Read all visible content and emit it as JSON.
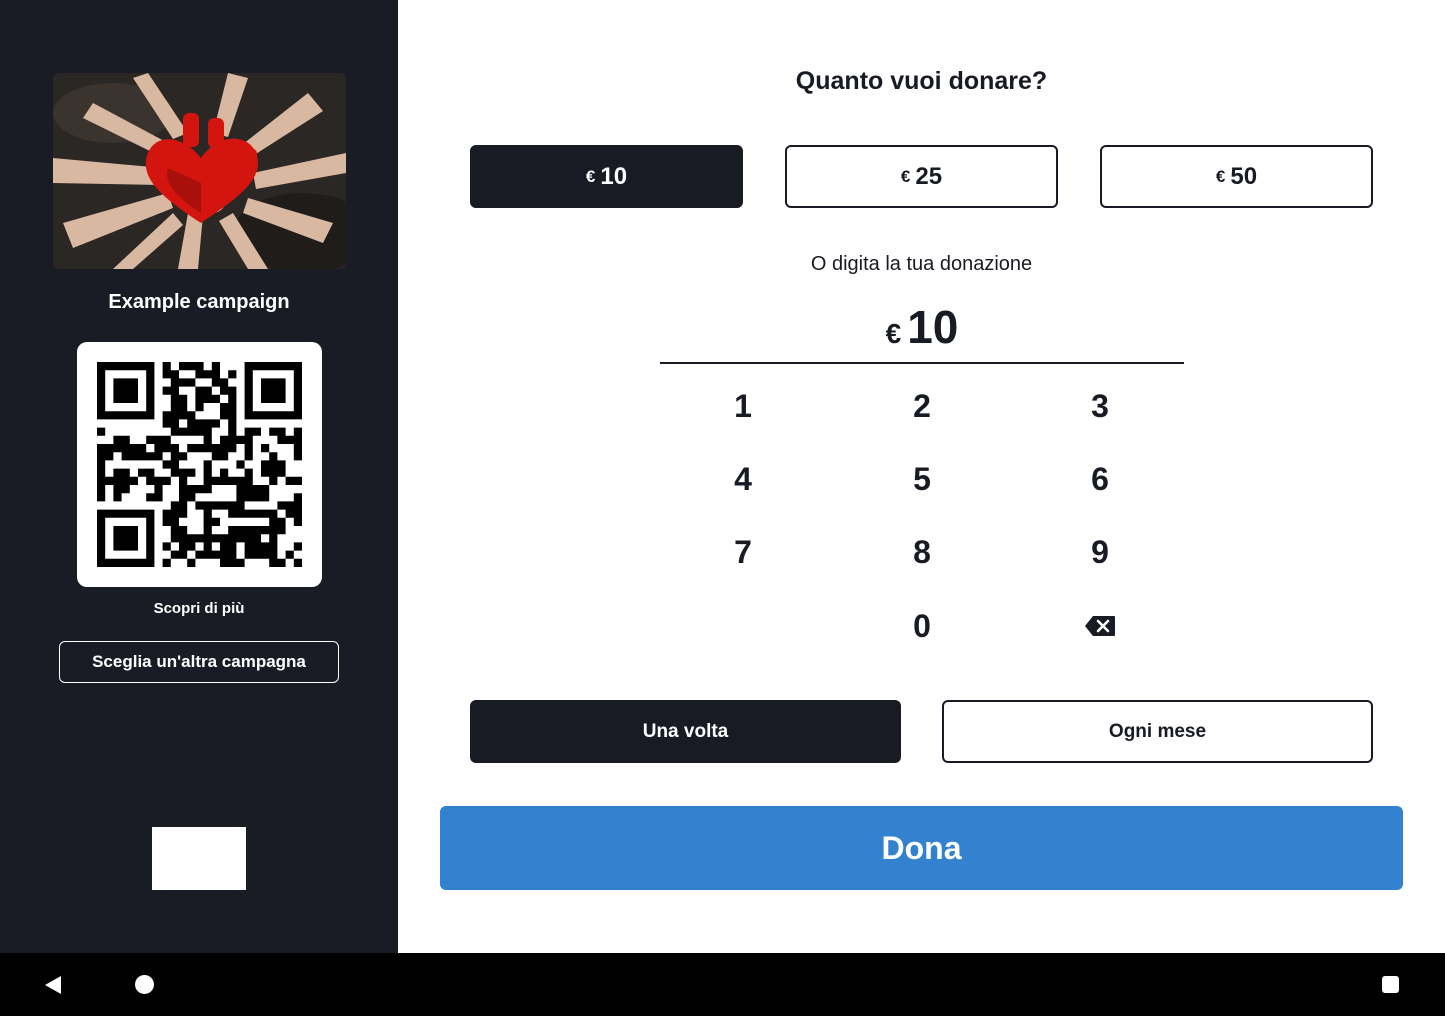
{
  "campaign": {
    "title": "Example campaign",
    "learn_more_label": "Scopri di più",
    "other_campaign_label": "Sceglia un'altra campagna"
  },
  "donation": {
    "heading": "Quanto vuoi donare?",
    "currency": "€",
    "presets": [
      {
        "value": "10",
        "selected": true
      },
      {
        "value": "25",
        "selected": false
      },
      {
        "value": "50",
        "selected": false
      }
    ],
    "custom_prompt": "O digita la tua donazione",
    "current_amount": "10",
    "keypad": [
      "1",
      "2",
      "3",
      "4",
      "5",
      "6",
      "7",
      "8",
      "9",
      "0"
    ],
    "frequency": [
      {
        "label": "Una volta",
        "selected": true
      },
      {
        "label": "Ogni mese",
        "selected": false
      }
    ],
    "donate_label": "Dona"
  },
  "colors": {
    "dark": "#191c25",
    "accent": "#3282cf",
    "white": "#ffffff"
  },
  "icons": {
    "backspace": "backspace-icon",
    "nav_back": "back-triangle-icon",
    "nav_home": "home-circle-icon",
    "nav_recents": "recents-square-icon"
  }
}
